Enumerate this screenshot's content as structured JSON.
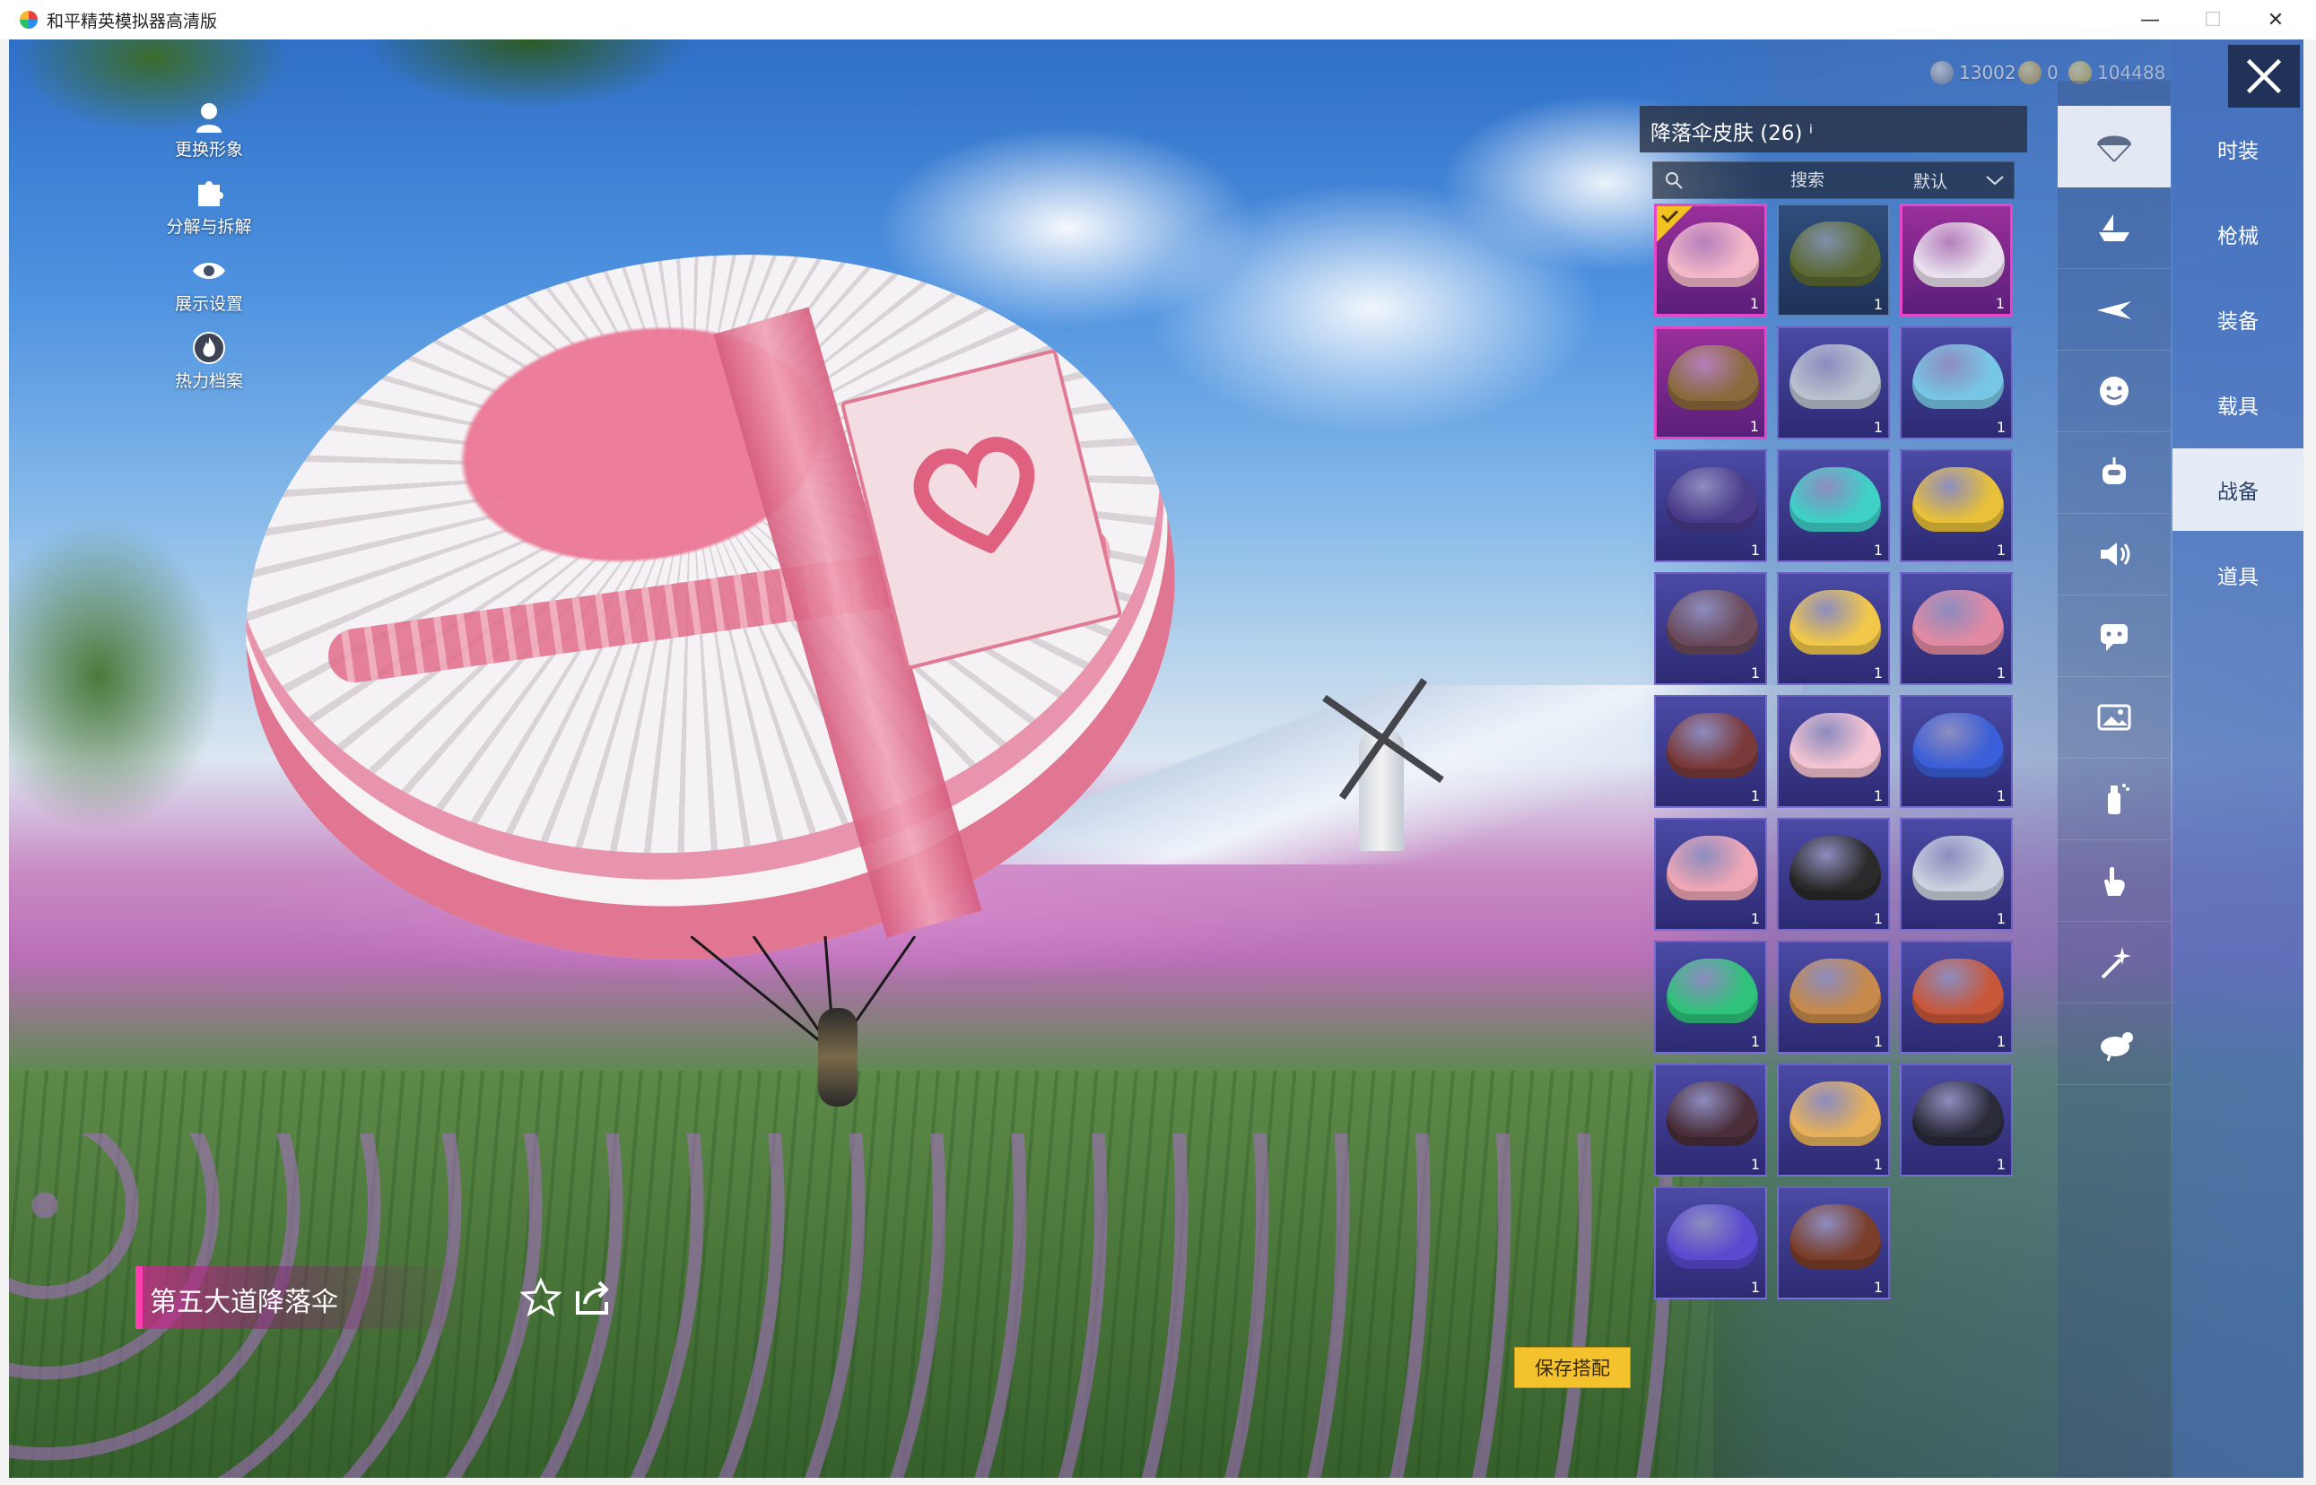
{
  "window": {
    "title": "和平精英模拟器高清版",
    "minimize": "—",
    "maximize": "☐",
    "close": "✕"
  },
  "side_menu": [
    {
      "label": "更换形象",
      "icon": "avatar-icon"
    },
    {
      "label": "分解与拆解",
      "icon": "puzzle-icon"
    },
    {
      "label": "展示设置",
      "icon": "eye-icon"
    },
    {
      "label": "热力档案",
      "icon": "flame-icon"
    }
  ],
  "currencies": [
    {
      "value": "13002",
      "icon": "silver-coin-icon",
      "color": "#8a9099"
    },
    {
      "value": "0",
      "icon": "gold-coupon-icon",
      "color": "#c9971f"
    },
    {
      "value": "104488",
      "icon": "yellow-coin-icon",
      "color": "#e2b21a"
    }
  ],
  "grid": {
    "title": "降落伞皮肤 (26)",
    "info": "ⁱ",
    "search_placeholder": "搜索",
    "sort_label": "默认"
  },
  "items": [
    {
      "qty": "1",
      "rarity": "legend",
      "color": "#f3b8c9",
      "equipped": true
    },
    {
      "qty": "1",
      "rarity": "blue",
      "color": "#5b6a34",
      "equipped": false
    },
    {
      "qty": "1",
      "rarity": "legend",
      "color": "#e9e1ee",
      "equipped": false
    },
    {
      "qty": "1",
      "rarity": "legend",
      "color": "#8a6a3c",
      "equipped": false
    },
    {
      "qty": "1",
      "rarity": "epic",
      "color": "#b9c2cf",
      "equipped": false
    },
    {
      "qty": "1",
      "rarity": "epic",
      "color": "#78c6e6",
      "equipped": false
    },
    {
      "qty": "1",
      "rarity": "epic",
      "color": "#4a3a8a",
      "equipped": false
    },
    {
      "qty": "1",
      "rarity": "epic",
      "color": "#3fd0c7",
      "equipped": false
    },
    {
      "qty": "1",
      "rarity": "epic",
      "color": "#e8c03a",
      "equipped": false
    },
    {
      "qty": "1",
      "rarity": "epic",
      "color": "#6a4a5a",
      "equipped": false
    },
    {
      "qty": "1",
      "rarity": "epic",
      "color": "#f1c84a",
      "equipped": false
    },
    {
      "qty": "1",
      "rarity": "epic",
      "color": "#e28aa3",
      "equipped": false
    },
    {
      "qty": "1",
      "rarity": "epic",
      "color": "#7a3a3a",
      "equipped": false
    },
    {
      "qty": "1",
      "rarity": "epic",
      "color": "#f4c4d2",
      "equipped": false
    },
    {
      "qty": "1",
      "rarity": "epic",
      "color": "#3b5fd8",
      "equipped": false
    },
    {
      "qty": "1",
      "rarity": "epic",
      "color": "#f0a7b6",
      "equipped": false
    },
    {
      "qty": "1",
      "rarity": "epic",
      "color": "#2a2a2a",
      "equipped": false
    },
    {
      "qty": "1",
      "rarity": "epic",
      "color": "#c9d2de",
      "equipped": false
    },
    {
      "qty": "1",
      "rarity": "epic",
      "color": "#2fc27a",
      "equipped": false
    },
    {
      "qty": "1",
      "rarity": "epic",
      "color": "#c78a4a",
      "equipped": false
    },
    {
      "qty": "1",
      "rarity": "epic",
      "color": "#c8583a",
      "equipped": false
    },
    {
      "qty": "1",
      "rarity": "epic",
      "color": "#4a2e3a",
      "equipped": false
    },
    {
      "qty": "1",
      "rarity": "epic",
      "color": "#e6b15a",
      "equipped": false
    },
    {
      "qty": "1",
      "rarity": "epic",
      "color": "#2b2b3a",
      "equipped": false
    },
    {
      "qty": "1",
      "rarity": "epic",
      "color": "#5a4ad0",
      "equipped": false
    },
    {
      "qty": "1",
      "rarity": "epic",
      "color": "#7a3e2a",
      "equipped": false
    }
  ],
  "icon_tabs": [
    {
      "icon": "parachute-icon",
      "active": true
    },
    {
      "icon": "boat-icon",
      "active": false
    },
    {
      "icon": "plane-icon",
      "active": false
    },
    {
      "icon": "face-icon",
      "active": false
    },
    {
      "icon": "robot-icon",
      "active": false
    },
    {
      "icon": "speaker-icon",
      "active": false
    },
    {
      "icon": "chat-icon",
      "active": false
    },
    {
      "icon": "picture-icon",
      "active": false
    },
    {
      "icon": "spray-icon",
      "active": false
    },
    {
      "icon": "hand-icon",
      "active": false
    },
    {
      "icon": "sparkle-icon",
      "active": false
    },
    {
      "icon": "chicken-icon",
      "active": false
    }
  ],
  "categories": [
    {
      "label": "时装",
      "active": false
    },
    {
      "label": "枪械",
      "active": false
    },
    {
      "label": "装备",
      "active": false
    },
    {
      "label": "载具",
      "active": false
    },
    {
      "label": "战备",
      "active": true
    },
    {
      "label": "道具",
      "active": false
    }
  ],
  "preview": {
    "name": "第五大道降落伞",
    "save_label": "保存搭配"
  }
}
